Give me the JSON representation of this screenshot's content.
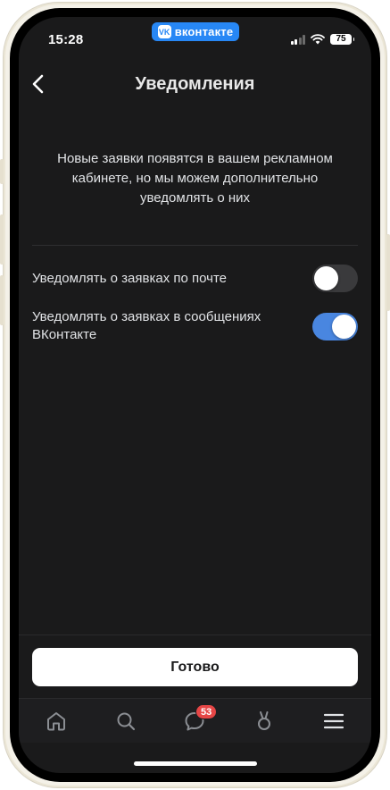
{
  "status_bar": {
    "time": "15:28",
    "app_pill": "вконтакте",
    "battery": "75"
  },
  "header": {
    "title": "Уведомления"
  },
  "intro": {
    "text": "Новые заявки появятся в вашем рекламном кабинете, но мы можем дополнительно уведомлять о них"
  },
  "settings": [
    {
      "label": "Уведомлять о заявках по почте",
      "enabled": false
    },
    {
      "label": "Уведомлять о заявках в сообщениях ВКонтакте",
      "enabled": true
    }
  ],
  "footer": {
    "done_label": "Готово"
  },
  "tabbar": {
    "messages_badge": "53"
  },
  "colors": {
    "background": "#1a1a1b",
    "accent": "#4986e0",
    "vk_brand": "#2787f5",
    "badge": "#e64646"
  }
}
